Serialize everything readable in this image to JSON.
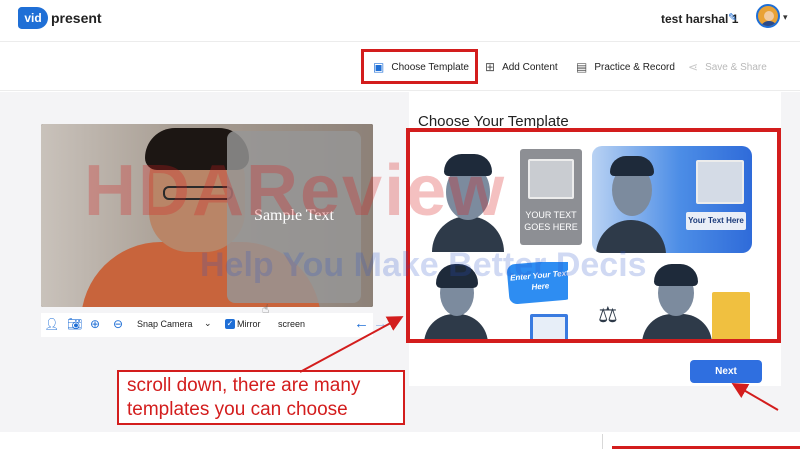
{
  "header": {
    "logo_mark": "vid",
    "logo_word": "present",
    "user_name": "test harshal 1",
    "edit_icon": "pencil-icon",
    "avatar_icon": "user-avatar"
  },
  "steps": [
    {
      "label": "Choose Template",
      "icon": "template-icon",
      "active": true
    },
    {
      "label": "Add Content",
      "icon": "add-content-icon"
    },
    {
      "label": "Practice & Record",
      "icon": "record-icon"
    },
    {
      "label": "Save & Share",
      "icon": "share-icon",
      "disabled": true
    }
  ],
  "preview": {
    "overlay_text": "Sample Text"
  },
  "camera_toolbar": {
    "camera_source": "Snap Camera",
    "mirror_label": "Mirror",
    "mirror_checked": true,
    "screen_label": "screen"
  },
  "templates_panel": {
    "title": "Choose Your Template",
    "template_texts": {
      "t2": "YOUR TEXT GOES HERE",
      "t3": "Your Text Here",
      "t4": "Enter Your Text Here"
    },
    "next_label": "Next"
  },
  "annotation": {
    "line1": "scroll down, there are many",
    "line2": "templates you can choose"
  },
  "watermark": {
    "line1": "HDAReview",
    "line2": "Help You Make Better Decis"
  },
  "colors": {
    "accent": "#2f6fe0",
    "annotation_red": "#d31d1d"
  }
}
